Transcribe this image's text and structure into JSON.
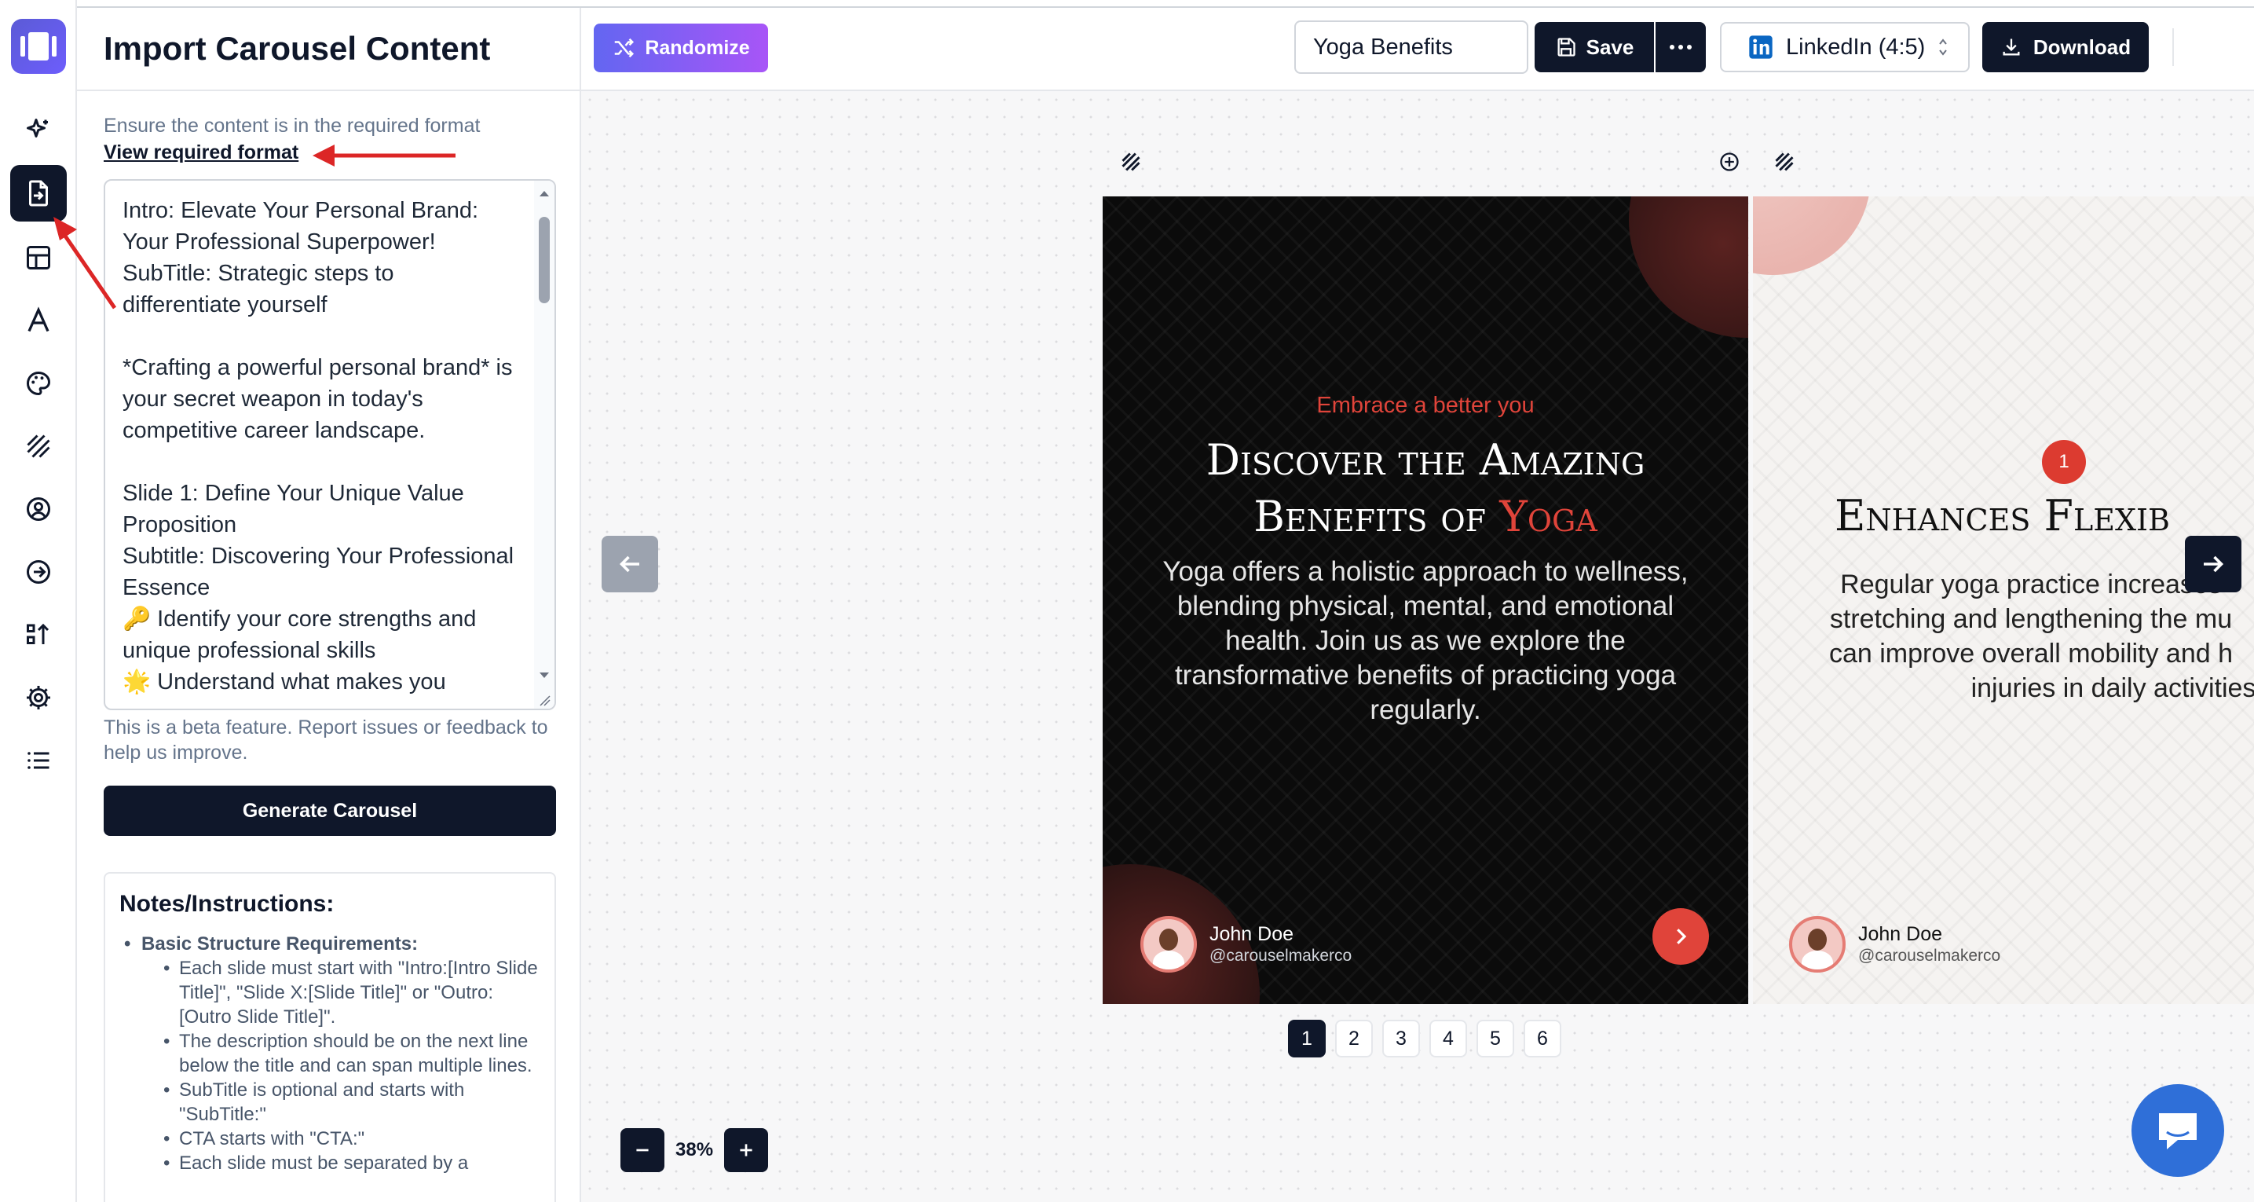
{
  "panel": {
    "title": "Import Carousel Content",
    "hint": "Ensure the content is in the required format",
    "format_link": "View required format",
    "textarea_value": "Intro: Elevate Your Personal Brand: Your Professional Superpower!\nSubTitle: Strategic steps to differentiate yourself\n\n*Crafting a powerful personal brand* is your secret weapon in today's competitive career landscape.\n\nSlide 1: Define Your Unique Value Proposition\nSubtitle: Discovering Your Professional Essence\n🔑 Identify your core strengths and unique professional skills\n🌟 Understand what makes you",
    "beta_note": "This is a beta feature. Report issues or feedback to help us improve.",
    "generate_label": "Generate Carousel",
    "notes_title": "Notes/Instructions:",
    "notes_heading": "Basic Structure Requirements:",
    "notes_items": [
      "Each slide must start with \"Intro:[Intro Slide Title]\", \"Slide X:[Slide Title]\" or \"Outro:[Outro Slide Title]\".",
      "The description should be on the next line below the title and can span multiple lines.",
      "SubTitle is optional and starts with \"SubTitle:\"",
      "CTA starts with \"CTA:\"",
      "Each slide must be separated by a"
    ]
  },
  "toolbar": {
    "randomize_label": "Randomize",
    "title_value": "Yoga Benefits",
    "save_label": "Save",
    "platform_label": "LinkedIn (4:5)",
    "download_label": "Download"
  },
  "slide1": {
    "kicker": "Embrace a better you",
    "title_line1": "Discover the Amazing",
    "title_line2_prefix": "Benefits of ",
    "title_accent": "Yoga",
    "description": "Yoga offers a holistic approach to wellness, blending physical, mental, and emotional health. Join us as we explore the transformative benefits of practicing yoga regularly.",
    "author_name": "John Doe",
    "author_handle": "@carouselmakerco"
  },
  "slide2": {
    "number": "1",
    "title": "Enhances Flexib",
    "desc_lines": [
      "Regular yoga practice increases",
      "stretching and lengthening the mu",
      "can improve overall mobility and h",
      "injuries in daily activities"
    ],
    "author_name": "John Doe",
    "author_handle": "@carouselmakerco"
  },
  "pager": [
    "1",
    "2",
    "3",
    "4",
    "5",
    "6"
  ],
  "zoom": "38%",
  "colors": {
    "accent": "#e0443a",
    "dark": "#0f172a",
    "brand": "#5b5bd6"
  }
}
